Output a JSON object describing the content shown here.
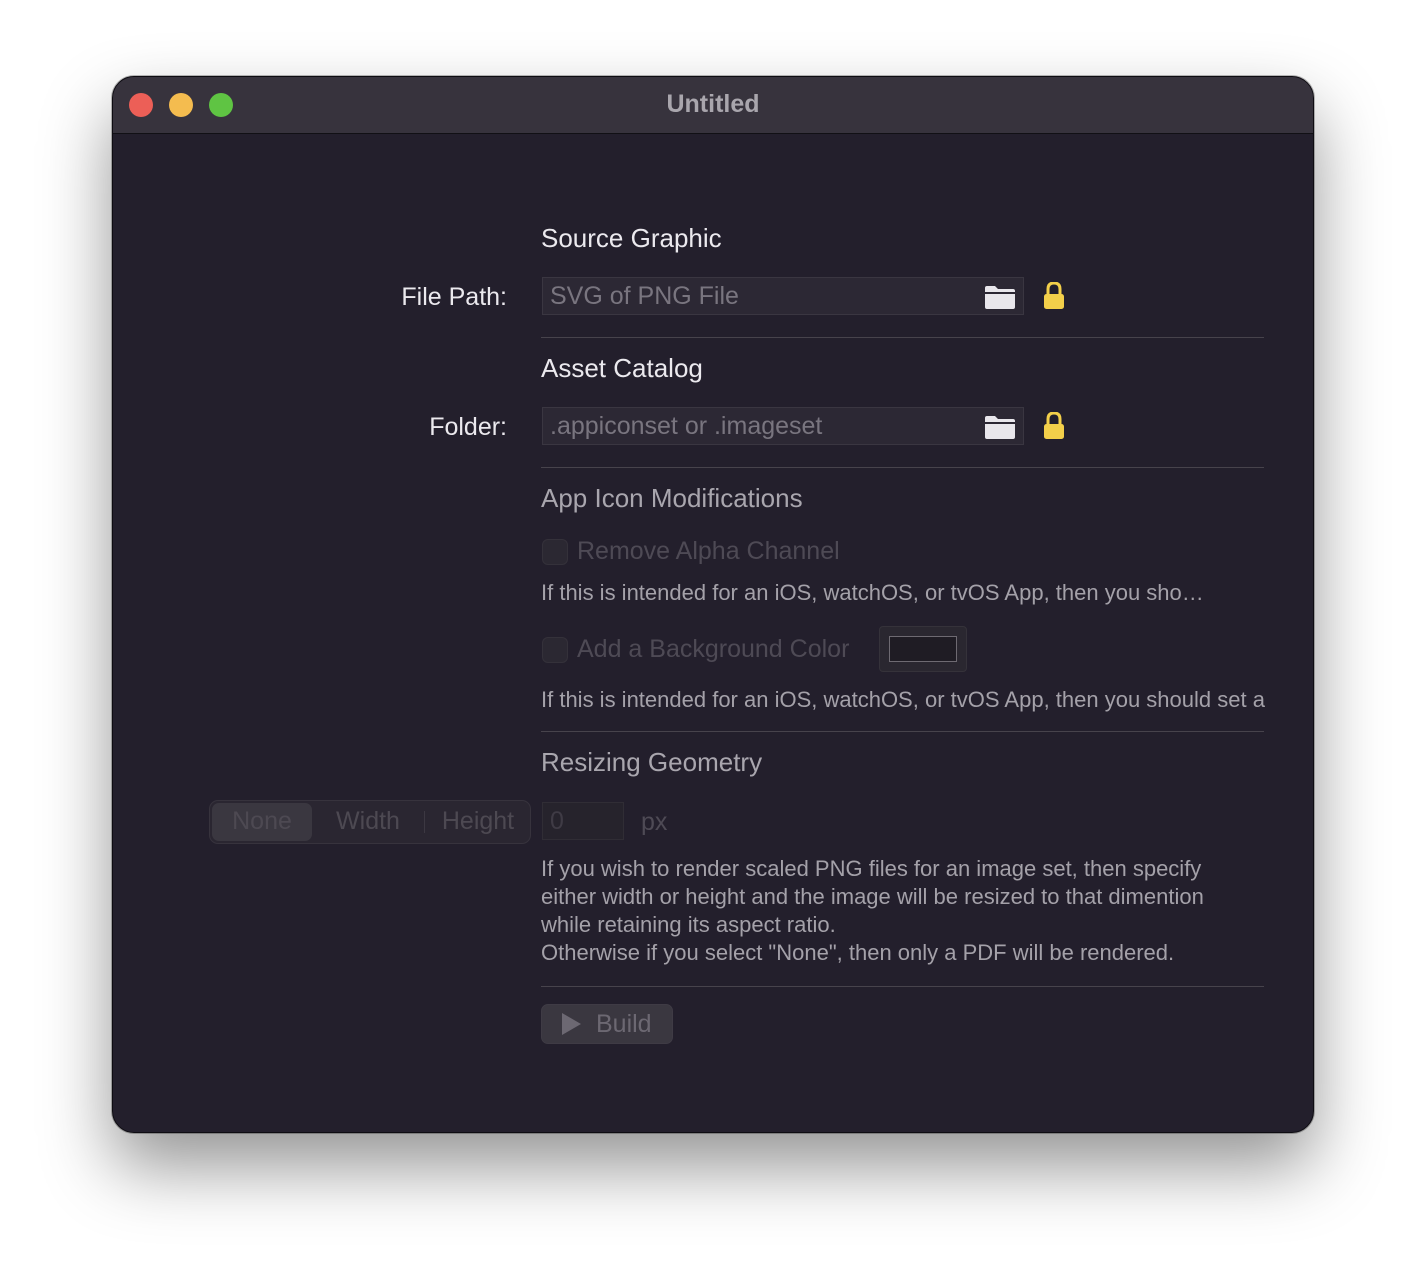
{
  "window": {
    "title": "Untitled"
  },
  "source_graphic": {
    "title": "Source Graphic",
    "file_path_label": "File Path:",
    "file_path_placeholder": "SVG of PNG File",
    "file_path_value": ""
  },
  "asset_catalog": {
    "title": "Asset Catalog",
    "folder_label": "Folder:",
    "folder_placeholder": ".appiconset or .imageset",
    "folder_value": ""
  },
  "app_icon_modifications": {
    "title": "App Icon Modifications",
    "remove_alpha": {
      "label": "Remove Alpha Channel",
      "checked": false,
      "help": "If this is intended for an iOS, watchOS, or tvOS App, then you sho…"
    },
    "background_color": {
      "label": "Add a Background Color",
      "checked": false,
      "help": "If this is intended for an iOS, watchOS, or tvOS App, then you should set a",
      "color": "#1f1c24"
    }
  },
  "resizing_geometry": {
    "title": "Resizing Geometry",
    "segments": [
      "None",
      "Width",
      "Height"
    ],
    "selected_segment": "None",
    "size_placeholder": "0",
    "size_value": "",
    "unit": "px",
    "help_lines": [
      "If you wish to render scaled PNG files for an image set, then specify",
      "either width or height and the image will be resized to that dimention",
      "while retaining its aspect ratio.",
      "Otherwise if you select \"None\", then only a PDF will be rendered."
    ]
  },
  "build": {
    "label": "Build"
  },
  "icons": {
    "folder": "folder-icon",
    "lock": "lock-icon",
    "play": "play-icon"
  },
  "colors": {
    "window_background": "#231f2c",
    "titlebar": "#37333d",
    "close": "#ec5f57",
    "minimize": "#f4bc4f",
    "zoom": "#5fc443",
    "lock": "#f3cf4a"
  }
}
